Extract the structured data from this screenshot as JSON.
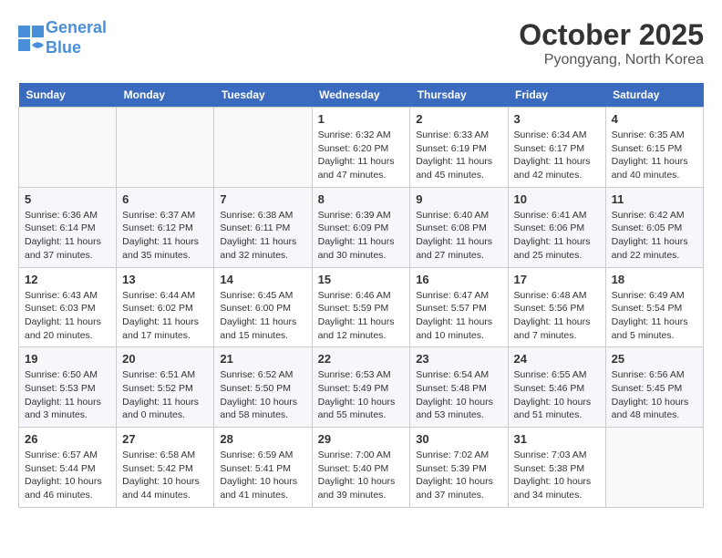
{
  "header": {
    "logo_line1": "General",
    "logo_line2": "Blue",
    "month": "October 2025",
    "location": "Pyongyang, North Korea"
  },
  "days_of_week": [
    "Sunday",
    "Monday",
    "Tuesday",
    "Wednesday",
    "Thursday",
    "Friday",
    "Saturday"
  ],
  "weeks": [
    [
      {
        "day": "",
        "info": ""
      },
      {
        "day": "",
        "info": ""
      },
      {
        "day": "",
        "info": ""
      },
      {
        "day": "1",
        "info": "Sunrise: 6:32 AM\nSunset: 6:20 PM\nDaylight: 11 hours and 47 minutes."
      },
      {
        "day": "2",
        "info": "Sunrise: 6:33 AM\nSunset: 6:19 PM\nDaylight: 11 hours and 45 minutes."
      },
      {
        "day": "3",
        "info": "Sunrise: 6:34 AM\nSunset: 6:17 PM\nDaylight: 11 hours and 42 minutes."
      },
      {
        "day": "4",
        "info": "Sunrise: 6:35 AM\nSunset: 6:15 PM\nDaylight: 11 hours and 40 minutes."
      }
    ],
    [
      {
        "day": "5",
        "info": "Sunrise: 6:36 AM\nSunset: 6:14 PM\nDaylight: 11 hours and 37 minutes."
      },
      {
        "day": "6",
        "info": "Sunrise: 6:37 AM\nSunset: 6:12 PM\nDaylight: 11 hours and 35 minutes."
      },
      {
        "day": "7",
        "info": "Sunrise: 6:38 AM\nSunset: 6:11 PM\nDaylight: 11 hours and 32 minutes."
      },
      {
        "day": "8",
        "info": "Sunrise: 6:39 AM\nSunset: 6:09 PM\nDaylight: 11 hours and 30 minutes."
      },
      {
        "day": "9",
        "info": "Sunrise: 6:40 AM\nSunset: 6:08 PM\nDaylight: 11 hours and 27 minutes."
      },
      {
        "day": "10",
        "info": "Sunrise: 6:41 AM\nSunset: 6:06 PM\nDaylight: 11 hours and 25 minutes."
      },
      {
        "day": "11",
        "info": "Sunrise: 6:42 AM\nSunset: 6:05 PM\nDaylight: 11 hours and 22 minutes."
      }
    ],
    [
      {
        "day": "12",
        "info": "Sunrise: 6:43 AM\nSunset: 6:03 PM\nDaylight: 11 hours and 20 minutes."
      },
      {
        "day": "13",
        "info": "Sunrise: 6:44 AM\nSunset: 6:02 PM\nDaylight: 11 hours and 17 minutes."
      },
      {
        "day": "14",
        "info": "Sunrise: 6:45 AM\nSunset: 6:00 PM\nDaylight: 11 hours and 15 minutes."
      },
      {
        "day": "15",
        "info": "Sunrise: 6:46 AM\nSunset: 5:59 PM\nDaylight: 11 hours and 12 minutes."
      },
      {
        "day": "16",
        "info": "Sunrise: 6:47 AM\nSunset: 5:57 PM\nDaylight: 11 hours and 10 minutes."
      },
      {
        "day": "17",
        "info": "Sunrise: 6:48 AM\nSunset: 5:56 PM\nDaylight: 11 hours and 7 minutes."
      },
      {
        "day": "18",
        "info": "Sunrise: 6:49 AM\nSunset: 5:54 PM\nDaylight: 11 hours and 5 minutes."
      }
    ],
    [
      {
        "day": "19",
        "info": "Sunrise: 6:50 AM\nSunset: 5:53 PM\nDaylight: 11 hours and 3 minutes."
      },
      {
        "day": "20",
        "info": "Sunrise: 6:51 AM\nSunset: 5:52 PM\nDaylight: 11 hours and 0 minutes."
      },
      {
        "day": "21",
        "info": "Sunrise: 6:52 AM\nSunset: 5:50 PM\nDaylight: 10 hours and 58 minutes."
      },
      {
        "day": "22",
        "info": "Sunrise: 6:53 AM\nSunset: 5:49 PM\nDaylight: 10 hours and 55 minutes."
      },
      {
        "day": "23",
        "info": "Sunrise: 6:54 AM\nSunset: 5:48 PM\nDaylight: 10 hours and 53 minutes."
      },
      {
        "day": "24",
        "info": "Sunrise: 6:55 AM\nSunset: 5:46 PM\nDaylight: 10 hours and 51 minutes."
      },
      {
        "day": "25",
        "info": "Sunrise: 6:56 AM\nSunset: 5:45 PM\nDaylight: 10 hours and 48 minutes."
      }
    ],
    [
      {
        "day": "26",
        "info": "Sunrise: 6:57 AM\nSunset: 5:44 PM\nDaylight: 10 hours and 46 minutes."
      },
      {
        "day": "27",
        "info": "Sunrise: 6:58 AM\nSunset: 5:42 PM\nDaylight: 10 hours and 44 minutes."
      },
      {
        "day": "28",
        "info": "Sunrise: 6:59 AM\nSunset: 5:41 PM\nDaylight: 10 hours and 41 minutes."
      },
      {
        "day": "29",
        "info": "Sunrise: 7:00 AM\nSunset: 5:40 PM\nDaylight: 10 hours and 39 minutes."
      },
      {
        "day": "30",
        "info": "Sunrise: 7:02 AM\nSunset: 5:39 PM\nDaylight: 10 hours and 37 minutes."
      },
      {
        "day": "31",
        "info": "Sunrise: 7:03 AM\nSunset: 5:38 PM\nDaylight: 10 hours and 34 minutes."
      },
      {
        "day": "",
        "info": ""
      }
    ]
  ]
}
